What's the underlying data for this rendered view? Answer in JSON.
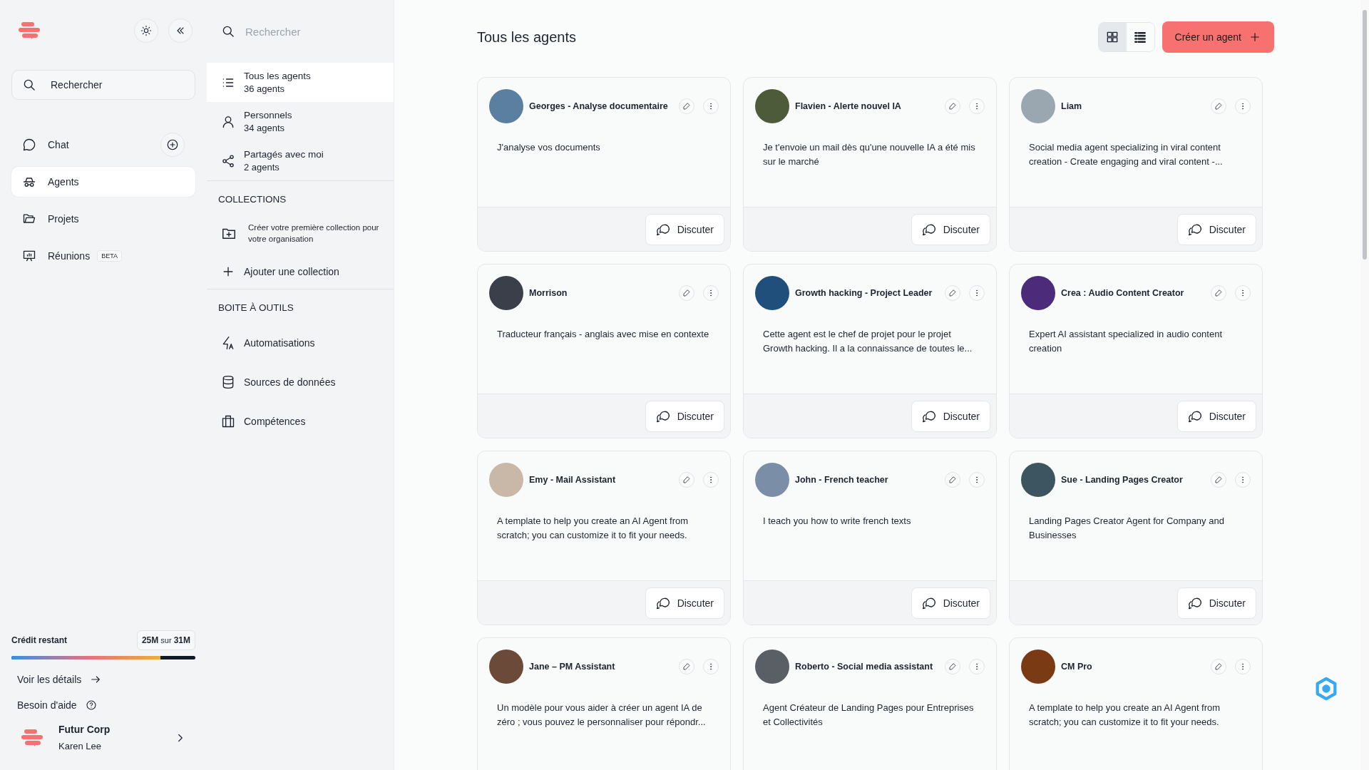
{
  "sidebar": {
    "search_label": "Rechercher",
    "nav": [
      {
        "label": "Chat",
        "selected": false,
        "has_add": true
      },
      {
        "label": "Agents",
        "selected": true
      },
      {
        "label": "Projets",
        "selected": false
      },
      {
        "label": "Réunions",
        "selected": false,
        "badge": "BETA"
      }
    ],
    "credit": {
      "label": "Crédit restant",
      "used": "25M",
      "sep": "sur",
      "total": "31M",
      "level": 0.81
    },
    "details_link": "Voir les détails",
    "help_link": "Besoin d'aide",
    "account": {
      "org": "Futur Corp",
      "user": "Karen Lee"
    }
  },
  "panel": {
    "search": {
      "placeholder": "Rechercher"
    },
    "filters": [
      {
        "label": "Tous les agents",
        "count": "36 agents",
        "selected": true
      },
      {
        "label": "Personnels",
        "count": "34 agents",
        "selected": false
      },
      {
        "label": "Partagés avec moi",
        "count": "2 agents",
        "selected": false
      }
    ],
    "collections": {
      "heading": "COLLECTIONS",
      "empty_text": "Créer votre première collection pour votre organisation",
      "add_label": "Ajouter une collection"
    },
    "toolbox": {
      "heading": "BOITE À OUTILS",
      "items": [
        "Automatisations",
        "Sources de données",
        "Compétences"
      ]
    }
  },
  "main": {
    "title": "Tous les agents",
    "view_modes": [
      {
        "selected": true
      },
      {
        "selected": false
      }
    ],
    "create_button": "Créer un agent",
    "agents": [
      {
        "name": "Georges - Analyse documentaire",
        "description": "J'analyse vos documents",
        "action": "Discuter"
      },
      {
        "name": "Flavien - Alerte nouvel IA",
        "description": "Je t'envoie un mail dès qu'une nouvelle IA a été mis sur le marché",
        "action": "Discuter"
      },
      {
        "name": "Liam",
        "description": "Social media agent specializing in viral content creation - Create engaging and viral content -...",
        "action": "Discuter"
      },
      {
        "name": "Morrison",
        "description": "Traducteur français - anglais avec mise en contexte",
        "action": "Discuter"
      },
      {
        "name": "Growth hacking - Project Leader",
        "description": "Cette agent est le chef de projet pour le projet Growth hacking. Il a la connaissance de toutes le...",
        "action": "Discuter"
      },
      {
        "name": "Crea : Audio Content Creator",
        "description": "Expert AI assistant specialized in audio content creation",
        "action": "Discuter"
      },
      {
        "name": "Emy - Mail Assistant",
        "description": "A template to help you create an AI Agent from scratch; you can customize it to fit your needs.",
        "action": "Discuter"
      },
      {
        "name": "John - French teacher",
        "description": "I teach you how to write french texts",
        "action": "Discuter"
      },
      {
        "name": "Sue - Landing Pages Creator",
        "description": "Landing Pages Creator Agent for Company and Businesses",
        "action": "Discuter"
      },
      {
        "name": "Jane – PM Assistant",
        "description": "Un modèle pour vous aider à créer un agent IA de zéro ; vous pouvez le personnaliser pour répondr..."
      },
      {
        "name": "Roberto - Social media assistant",
        "description": "Agent Créateur de Landing Pages pour Entreprises et Collectivités"
      },
      {
        "name": "CM Pro",
        "description": "A template to help you create an AI Agent from scratch; you can customize it to fit your needs."
      }
    ]
  }
}
